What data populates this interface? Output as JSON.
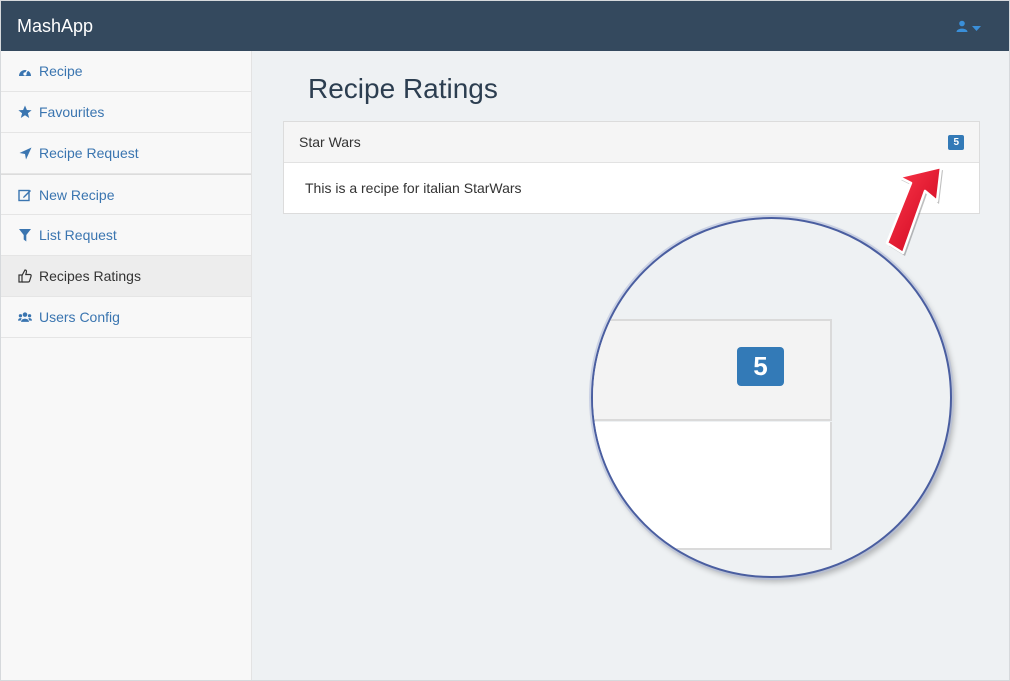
{
  "app": {
    "brand": "MashApp"
  },
  "sidebar": {
    "items": [
      {
        "label": "Recipe",
        "icon": "dashboard-icon"
      },
      {
        "label": "Favourites",
        "icon": "star-icon"
      },
      {
        "label": "Recipe Request",
        "icon": "send-icon"
      },
      {
        "label": "New Recipe",
        "icon": "edit-icon"
      },
      {
        "label": "List Request",
        "icon": "filter-icon"
      },
      {
        "label": "Recipes Ratings",
        "icon": "thumbs-up-icon"
      },
      {
        "label": "Users Config",
        "icon": "users-icon"
      }
    ]
  },
  "main": {
    "title": "Recipe Ratings",
    "panel": {
      "title": "Star Wars",
      "badge": "5",
      "body": "This is a recipe for italian StarWars"
    },
    "zoom": {
      "badge": "5"
    }
  },
  "colors": {
    "navbar": "#34495e",
    "accent": "#337ab7",
    "link": "#3a75b0",
    "arrow": "#e8102b"
  }
}
